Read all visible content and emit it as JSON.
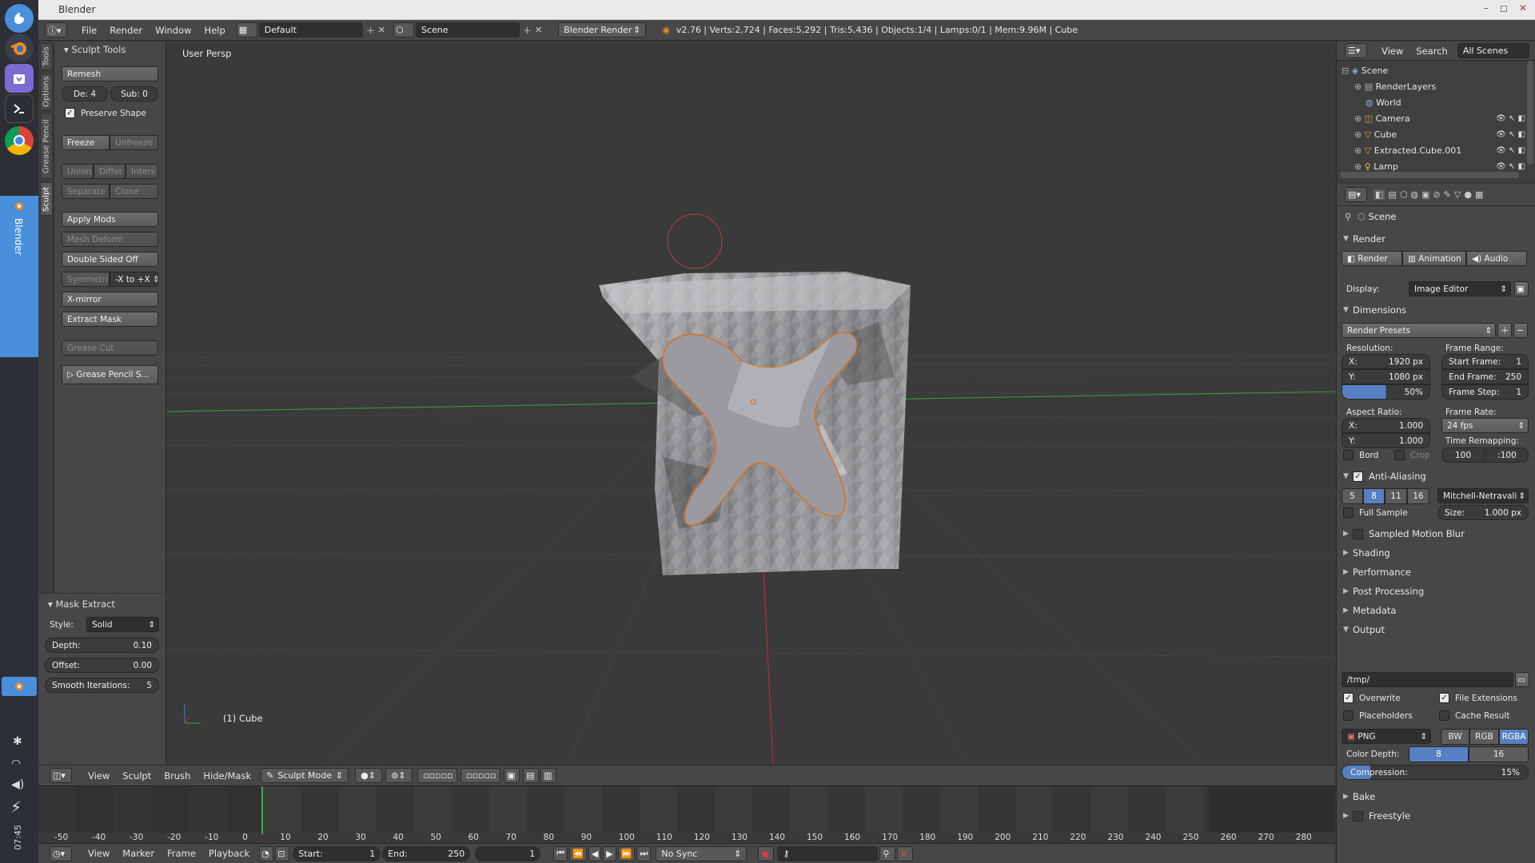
{
  "window": {
    "title": "Blender",
    "minimize": "–",
    "restore": "◻",
    "close": "✕"
  },
  "dock": {
    "active_label": "Blender",
    "clock": "07:45"
  },
  "infobar": {
    "menus": [
      "File",
      "Render",
      "Window",
      "Help"
    ],
    "layout": "Default",
    "scene": "Scene",
    "engine": "Blender Render",
    "stats": "v2.76 | Verts:2,724 | Faces:5,292 | Tris:5,436 | Objects:1/4 | Lamps:0/1 | Mem:9.96M | Cube"
  },
  "tabs": {
    "tools": "Tools",
    "options": "Options",
    "grease": "Grease Pencil",
    "sculpt": "Sculpt"
  },
  "sculpt_tools": {
    "title": "Sculpt Tools",
    "remesh": "Remesh",
    "depth": "De: 4",
    "sub": "Sub: 0",
    "preserve_shape": "Preserve Shape",
    "freeze": "Freeze",
    "unfreeze": "Unfreeze",
    "union": "Union",
    "differ": "Differ",
    "inters": "Inters",
    "separate": "Separate",
    "clone": "Clone",
    "apply_mods": "Apply Mods",
    "mesh_deform": "Mesh Deform",
    "double_sided": "Double Sided Off",
    "symmetri": "Symmetri",
    "sym_axis": "-X to +X",
    "xmirror": "X-mirror",
    "extract_mask": "Extract Mask",
    "grease_cut": "Grease Cut",
    "grease_pencil_s": "Grease Pencil S..."
  },
  "mask_extract": {
    "title": "Mask Extract",
    "style_label": "Style:",
    "style_value": "Solid",
    "depth": "Depth:",
    "depth_value": "0.10",
    "offset": "Offset:",
    "offset_value": "0.00",
    "smooth": "Smooth Iterations:",
    "smooth_value": "5"
  },
  "viewport": {
    "view_name": "User Persp",
    "object_label": "(1) Cube"
  },
  "viewport_header": {
    "menus": [
      "View",
      "Sculpt",
      "Brush",
      "Hide/Mask"
    ],
    "mode": "Sculpt Mode"
  },
  "timeline": {
    "ticks": [
      "-50",
      "-40",
      "-30",
      "-20",
      "-10",
      "0",
      "10",
      "20",
      "30",
      "40",
      "50",
      "60",
      "70",
      "80",
      "90",
      "100",
      "110",
      "120",
      "130",
      "140",
      "150",
      "160",
      "170",
      "180",
      "190",
      "200",
      "210",
      "220",
      "230",
      "240",
      "250",
      "260",
      "270",
      "280"
    ],
    "menus": [
      "View",
      "Marker",
      "Frame",
      "Playback"
    ],
    "start": "Start:",
    "start_value": "1",
    "end": "End:",
    "end_value": "250",
    "current": "1",
    "sync": "No Sync"
  },
  "outliner": {
    "view": "View",
    "search": "Search",
    "filter": "All Scenes",
    "rows": [
      "Scene",
      "RenderLayers",
      "World",
      "Camera",
      "Cube",
      "Extracted.Cube.001",
      "Lamp"
    ]
  },
  "properties": {
    "context": "Scene",
    "render": "Render",
    "render_btn": "Render",
    "animation_btn": "Animation",
    "audio_btn": "Audio",
    "display_label": "Display:",
    "display_value": "Image Editor",
    "dimensions": "Dimensions",
    "presets": "Render Presets",
    "resolution": "Resolution:",
    "res_x": "X:",
    "res_x_value": "1920 px",
    "res_y": "Y:",
    "res_y_value": "1080 px",
    "res_pct": "50%",
    "frame_range": "Frame Range:",
    "start_frame": "Start Frame:",
    "start_frame_value": "1",
    "end_frame": "End Frame:",
    "end_frame_value": "250",
    "frame_step": "Frame Step:",
    "frame_step_value": "1",
    "aspect": "Aspect Ratio:",
    "asp_x": "X:",
    "asp_x_value": "1.000",
    "asp_y": "Y:",
    "asp_y_value": "1.000",
    "frame_rate": "Frame Rate:",
    "frame_rate_value": "24 fps",
    "time_remap": "Time Remapping:",
    "remap_old": "100",
    "remap_new": ":100",
    "bord": "Bord",
    "crop": "Crop",
    "aa": "Anti-Aliasing",
    "aa_5": "5",
    "aa_8": "8",
    "aa_11": "11",
    "aa_16": "16",
    "aa_filter": "Mitchell-Netravali",
    "full_sample": "Full Sample",
    "aa_size": "Size:",
    "aa_size_value": "1.000 px",
    "sampled_motion_blur": "Sampled Motion Blur",
    "shading": "Shading",
    "performance": "Performance",
    "post_processing": "Post Processing",
    "metadata": "Metadata",
    "output": "Output",
    "output_path": "/tmp/",
    "overwrite": "Overwrite",
    "file_ext": "File Extensions",
    "placeholders": "Placeholders",
    "cache_result": "Cache Result",
    "format": "PNG",
    "bw": "BW",
    "rgb": "RGB",
    "rgba": "RGBA",
    "color_depth": "Color Depth:",
    "depth_8": "8",
    "depth_16": "16",
    "compression": "Compression:",
    "compression_value": "15%",
    "compression_fraction": 0.15,
    "bake": "Bake",
    "freestyle": "Freestyle"
  },
  "colors": {
    "accent": "#5680c2",
    "mask_outline": "#d4742a",
    "x_axis": "#b03030",
    "y_axis": "#3d8f3d"
  }
}
